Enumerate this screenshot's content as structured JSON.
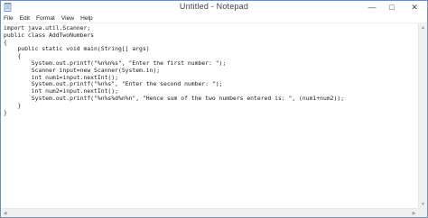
{
  "window": {
    "title": "Untitled - Notepad",
    "controls": {
      "minimize_glyph": "—",
      "maximize_glyph": "□",
      "close_glyph": "✕"
    },
    "app_icon": "notepad-icon"
  },
  "menubar": {
    "items": [
      "File",
      "Edit",
      "Format",
      "View",
      "Help"
    ]
  },
  "editor": {
    "text": "import java.util.Scanner;\npublic class AddTwoNumbers\n{\n    public static void main(String[] args)\n    {\n        System.out.printf(\"%n%n%s\", \"Enter the first number: \");\n        Scanner input=new Scanner(System.in);\n        int num1=input.nextInt();\n        System.out.printf(\"%n%s\", \"Enter the second number: \");\n        int num2=input.nextInt();\n        System.out.printf(\"%n%s%d%n%n\", \"Hence sum of the two numbers entered is: \", (num1+num2));\n    }\n}"
  },
  "scrollbars": {
    "up_glyph": "▲",
    "down_glyph": "▼",
    "left_glyph": "◀",
    "right_glyph": "▶"
  }
}
